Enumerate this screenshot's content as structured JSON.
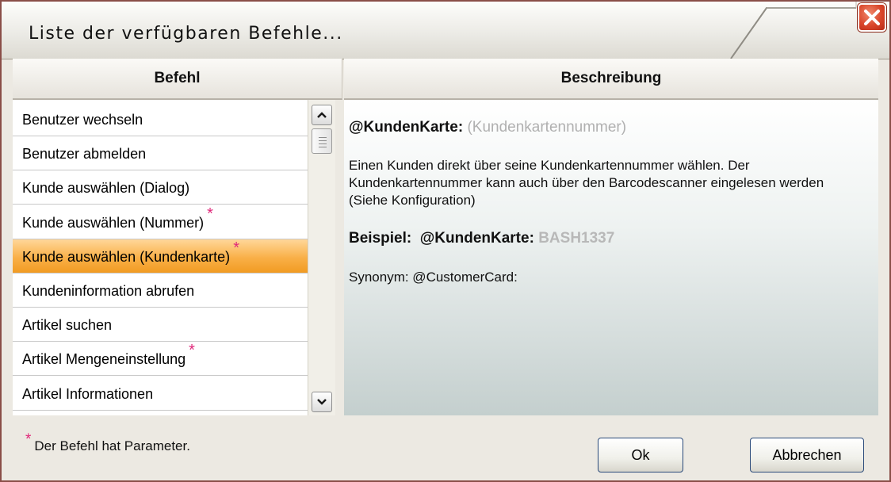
{
  "window": {
    "title": "Liste der verfügbaren Befehle..."
  },
  "columns": {
    "command": "Befehl",
    "description": "Beschreibung"
  },
  "commands": [
    {
      "label": "Benutzer wechseln",
      "has_params": false
    },
    {
      "label": "Benutzer abmelden",
      "has_params": false
    },
    {
      "label": "Kunde auswählen (Dialog)",
      "has_params": false
    },
    {
      "label": "Kunde auswählen (Nummer)",
      "has_params": true
    },
    {
      "label": "Kunde auswählen (Kundenkarte)",
      "has_params": true,
      "selected": true
    },
    {
      "label": "Kundeninformation abrufen",
      "has_params": false
    },
    {
      "label": "Artikel suchen",
      "has_params": false
    },
    {
      "label": "Artikel Mengeneinstellung",
      "has_params": true
    },
    {
      "label": "Artikel Informationen",
      "has_params": false
    }
  ],
  "star": "*",
  "detail": {
    "command": "@KundenKarte:",
    "parameter": "(Kundenkartennummer)",
    "text": "Einen Kunden direkt über seine Kundenkartennummer wählen. Der Kundenkartennummer kann auch über den Barcodescanner eingelesen werden (Siehe Konfiguration)",
    "example_label": "Beispiel:",
    "example_command": "@KundenKarte:",
    "example_value": "BASH1337",
    "synonym": "Synonym: @CustomerCard:"
  },
  "footer": {
    "note": "Der Befehl hat Parameter.",
    "ok_label": "Ok",
    "cancel_label": "Abbrechen"
  },
  "colors": {
    "selection": "#f9b048",
    "star": "#e0287a",
    "close": "#d9452a"
  }
}
